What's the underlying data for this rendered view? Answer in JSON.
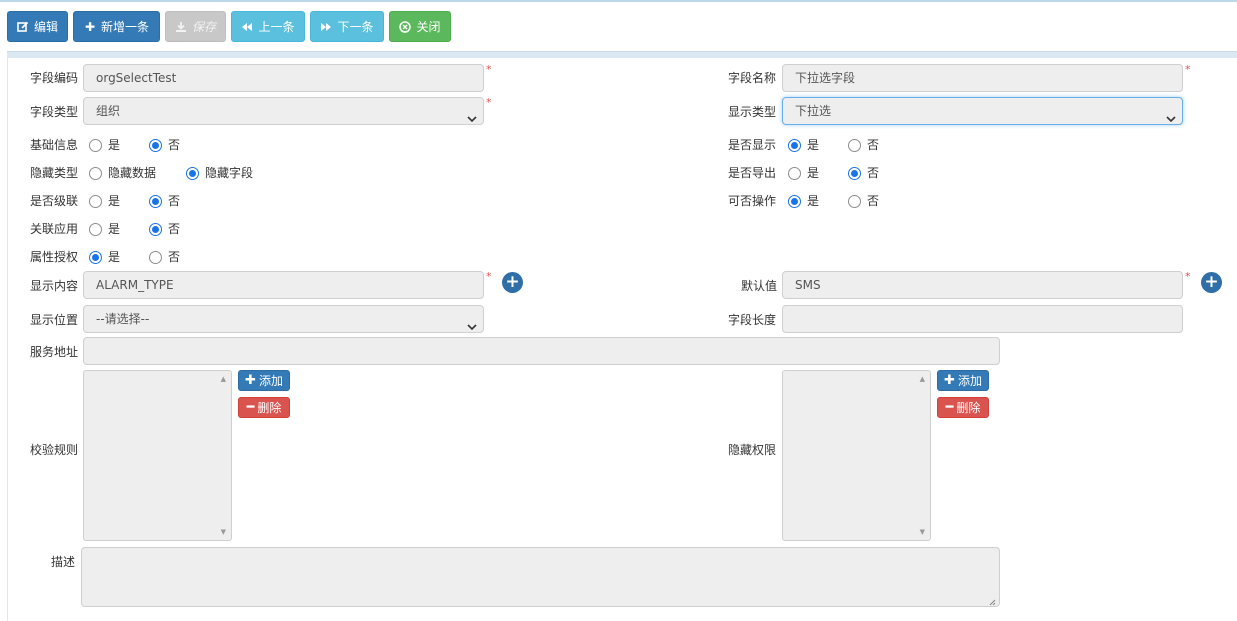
{
  "toolbar": {
    "edit": "编辑",
    "add_new": "新增一条",
    "save": "保存",
    "prev": "上一条",
    "next": "下一条",
    "close": "关闭"
  },
  "form": {
    "field_code": {
      "label": "字段编码",
      "value": "orgSelectTest"
    },
    "field_name": {
      "label": "字段名称",
      "value": "下拉选字段"
    },
    "field_type": {
      "label": "字段类型",
      "value": "组织"
    },
    "display_type": {
      "label": "显示类型",
      "value": "下拉选"
    },
    "basic_info": {
      "label": "基础信息",
      "options": [
        "是",
        "否"
      ],
      "selected": "否"
    },
    "is_display": {
      "label": "是否显示",
      "options": [
        "是",
        "否"
      ],
      "selected": "是"
    },
    "hide_type": {
      "label": "隐藏类型",
      "options": [
        "隐藏数据",
        "隐藏字段"
      ],
      "selected": "隐藏字段"
    },
    "is_export": {
      "label": "是否导出",
      "options": [
        "是",
        "否"
      ],
      "selected": "否"
    },
    "is_cascade": {
      "label": "是否级联",
      "options": [
        "是",
        "否"
      ],
      "selected": "否"
    },
    "operable": {
      "label": "可否操作",
      "options": [
        "是",
        "否"
      ],
      "selected": "是"
    },
    "related_app": {
      "label": "关联应用",
      "options": [
        "是",
        "否"
      ],
      "selected": "否"
    },
    "attr_auth": {
      "label": "属性授权",
      "options": [
        "是",
        "否"
      ],
      "selected": "是"
    },
    "display_content": {
      "label": "显示内容",
      "value": "ALARM_TYPE"
    },
    "default_value": {
      "label": "默认值",
      "value": "SMS"
    },
    "display_position": {
      "label": "显示位置",
      "value": "--请选择--"
    },
    "field_length": {
      "label": "字段长度",
      "value": ""
    },
    "service_url": {
      "label": "服务地址",
      "value": ""
    },
    "validation_rules": {
      "label": "校验规则"
    },
    "hidden_permissions": {
      "label": "隐藏权限"
    },
    "description": {
      "label": "描述",
      "value": ""
    },
    "list_add": "添加",
    "list_delete": "删除"
  },
  "colors": {
    "primary": "#337ab7",
    "info": "#5bc0de",
    "success": "#5cb85c",
    "danger": "#d9534f",
    "radio": "#1a73e8"
  },
  "icons": [
    "edit-icon",
    "plus-icon",
    "download-icon",
    "backward-icon",
    "forward-icon",
    "close-circle-icon",
    "plus-circle-icon",
    "minus-icon",
    "chevron-down-icon"
  ]
}
